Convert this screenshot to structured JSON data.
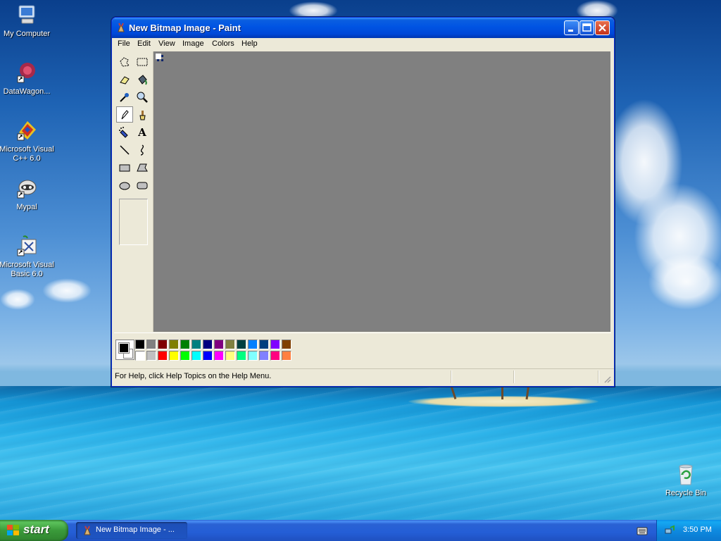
{
  "desktop": {
    "icons": [
      {
        "label": "My Computer",
        "icon": "my-computer-icon"
      },
      {
        "label": "DataWagon...",
        "icon": "datawagon-icon"
      },
      {
        "label": "Microsoft Visual C++ 6.0",
        "icon": "visual-cpp-icon"
      },
      {
        "label": "Mypal",
        "icon": "mypal-icon"
      },
      {
        "label": "Microsoft Visual Basic 6.0",
        "icon": "visual-basic-icon"
      },
      {
        "label": "Recycle Bin",
        "icon": "recycle-bin-icon"
      }
    ]
  },
  "window": {
    "title": "New Bitmap Image - Paint",
    "menu": [
      "File",
      "Edit",
      "View",
      "Image",
      "Colors",
      "Help"
    ],
    "tools": [
      "free-form-select",
      "select",
      "eraser",
      "fill-with-color",
      "pick-color",
      "magnifier",
      "pencil",
      "brush",
      "airbrush",
      "text",
      "line",
      "curve",
      "rectangle",
      "polygon",
      "ellipse",
      "rounded-rectangle"
    ],
    "active_tool": "pencil",
    "text_tool_glyph": "A",
    "foreground_color": "#000000",
    "background_color": "#ffffff",
    "palette_top": [
      "#000000",
      "#808080",
      "#800000",
      "#808000",
      "#008000",
      "#008080",
      "#000080",
      "#800080",
      "#808040",
      "#004040",
      "#0080ff",
      "#004080",
      "#8000ff",
      "#804000"
    ],
    "palette_bottom": [
      "#ffffff",
      "#c0c0c0",
      "#ff0000",
      "#ffff00",
      "#00ff00",
      "#00ffff",
      "#0000ff",
      "#ff00ff",
      "#ffff80",
      "#00ff80",
      "#80ffff",
      "#8080ff",
      "#ff0080",
      "#ff8040"
    ],
    "status_text": "For Help, click Help Topics on the Help Menu."
  },
  "taskbar": {
    "start_label": "start",
    "tasks": [
      {
        "label": "New Bitmap Image - ..."
      }
    ],
    "clock": "3:50 PM"
  },
  "colors": {
    "titlebar": "#0054e3",
    "window_face": "#ece9d8",
    "canvas_area": "#808080",
    "taskbar": "#245ed6",
    "start_button": "#3a9a3a"
  }
}
